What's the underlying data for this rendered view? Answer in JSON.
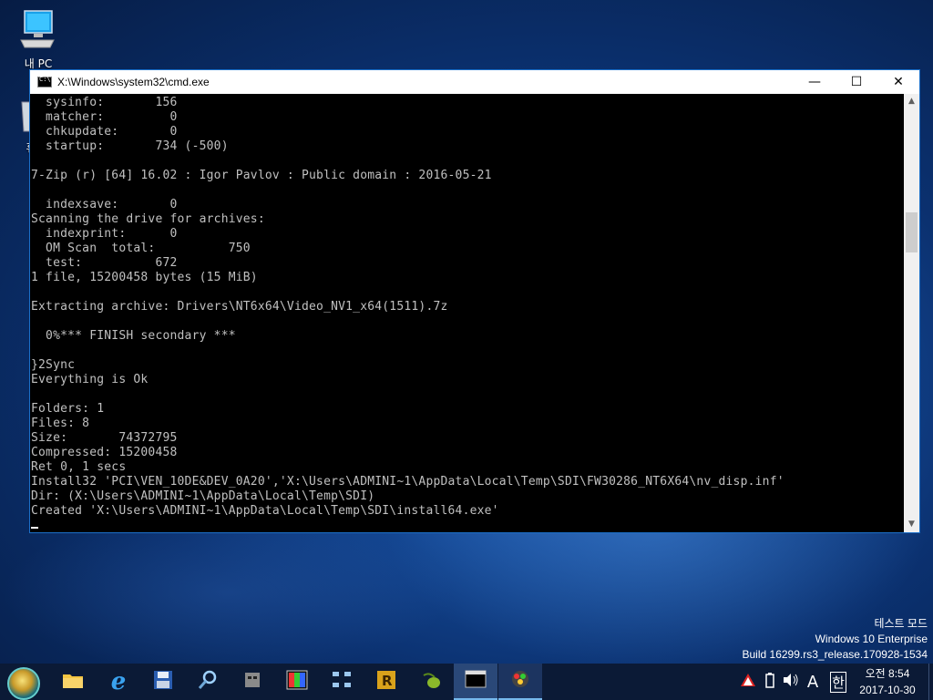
{
  "desktop": {
    "icons": [
      {
        "label": "내 PC",
        "icon": "computer-icon"
      },
      {
        "label": "휴",
        "icon": "recycle-bin-icon"
      }
    ],
    "watermark": [
      "테스트 모드",
      "Windows 10 Enterprise",
      "Build 16299.rs3_release.170928-1534"
    ]
  },
  "window": {
    "title": "X:\\Windows\\system32\\cmd.exe",
    "minimize": "—",
    "maximize": "☐",
    "close": "✕",
    "lines": [
      "  sysinfo:       156",
      "  matcher:         0",
      "  chkupdate:       0",
      "  startup:       734 (-500)",
      "",
      "7-Zip (r) [64] 16.02 : Igor Pavlov : Public domain : 2016-05-21",
      "",
      "  indexsave:       0",
      "Scanning the drive for archives:",
      "  indexprint:      0",
      "  OM Scan  total:          750",
      "  test:          672",
      "1 file, 15200458 bytes (15 MiB)",
      "",
      "Extracting archive: Drivers\\NT6x64\\Video_NV1_x64(1511).7z",
      "",
      "  0%*** FINISH secondary ***",
      "",
      "}2Sync",
      "Everything is Ok",
      "",
      "Folders: 1",
      "Files: 8",
      "Size:       74372795",
      "Compressed: 15200458",
      "Ret 0, 1 secs",
      "Install32 'PCI\\VEN_10DE&DEV_0A20','X:\\Users\\ADMINI~1\\AppData\\Local\\Temp\\SDI\\FW30286_NT6X64\\nv_disp.inf'",
      "Dir: (X:\\Users\\ADMINI~1\\AppData\\Local\\Temp\\SDI)",
      "Created 'X:\\Users\\ADMINI~1\\AppData\\Local\\Temp\\SDI\\install64.exe'"
    ]
  },
  "taskbar": {
    "items": [
      {
        "icon": "file-explorer-icon"
      },
      {
        "icon": "internet-explorer-icon"
      },
      {
        "icon": "floppy-save-icon"
      },
      {
        "icon": "search-magnifier-icon"
      },
      {
        "icon": "robot-app-icon"
      },
      {
        "icon": "color-grid-icon"
      },
      {
        "icon": "network-icon"
      },
      {
        "icon": "r-app-icon"
      },
      {
        "icon": "olive-app-icon"
      },
      {
        "icon": "cmd-icon"
      },
      {
        "icon": "driver-installer-icon"
      }
    ],
    "tray": {
      "ime_mode": "A",
      "ime_lang": "한",
      "time": "오전 8:54",
      "date": "2017-10-30"
    }
  }
}
